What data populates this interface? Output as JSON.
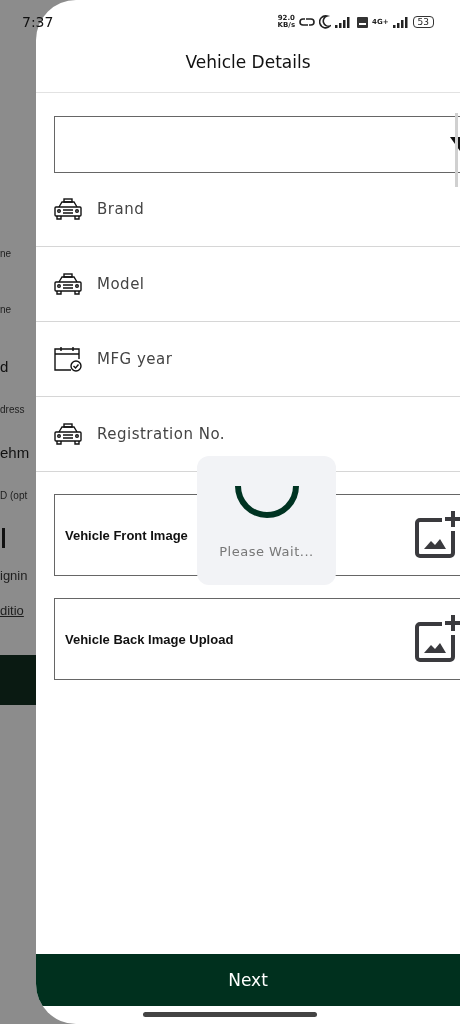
{
  "status_bar": {
    "time": "7:37",
    "speed_value": "92.0",
    "speed_unit": "KB/s",
    "network": "4G+",
    "battery": "53"
  },
  "background_form": {
    "fragments": [
      {
        "kind": "label",
        "text": "ne"
      },
      {
        "kind": "label",
        "text": "ne"
      },
      {
        "kind": "value",
        "text": "d"
      },
      {
        "kind": "label",
        "text": "dress"
      },
      {
        "kind": "value",
        "text": "ehm"
      },
      {
        "kind": "label",
        "text": "D (opt"
      },
      {
        "kind": "cursor"
      },
      {
        "kind": "text",
        "text": "ignin"
      },
      {
        "kind": "link",
        "text": "ditio"
      },
      {
        "kind": "button"
      }
    ]
  },
  "sheet": {
    "title": "Vehicle Details",
    "fields": [
      {
        "kind": "car",
        "label": "Brand"
      },
      {
        "kind": "car",
        "label": "Model"
      },
      {
        "kind": "calendar",
        "label": "MFG year"
      },
      {
        "kind": "car",
        "label": "Registration No."
      }
    ],
    "uploads": [
      {
        "label": "Vehicle Front Image"
      },
      {
        "label": "Vehicle Back Image Upload"
      }
    ],
    "next_button": "Next"
  },
  "loading": {
    "message": "Please Wait..."
  }
}
